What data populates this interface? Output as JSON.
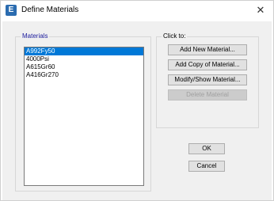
{
  "window": {
    "title": "Define Materials",
    "icon_letter": "E",
    "close_glyph": "✕"
  },
  "materials": {
    "label": "Materials",
    "items": [
      "A992Fy50",
      "4000Psi",
      "A615Gr60",
      "A416Gr270"
    ],
    "selected": "A992Fy50"
  },
  "click_to": {
    "label": "Click to:",
    "add_new": "Add New Material...",
    "add_copy": "Add Copy of Material...",
    "modify_show": "Modify/Show Material...",
    "delete": "Delete Material"
  },
  "buttons": {
    "ok": "OK",
    "cancel": "Cancel"
  }
}
